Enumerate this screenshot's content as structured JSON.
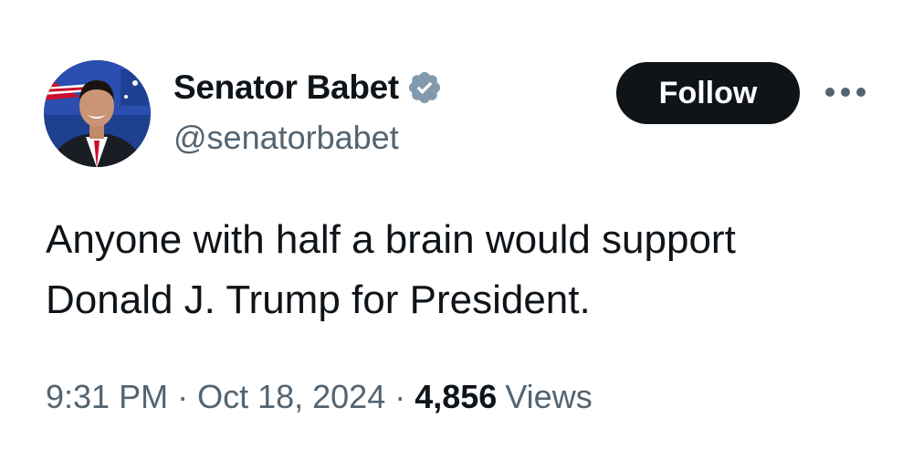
{
  "author": {
    "display_name": "Senator Babet",
    "handle": "@senatorbabet",
    "verified_badge_color": "#829aab",
    "avatar_icon": "profile-photo"
  },
  "actions": {
    "follow_label": "Follow",
    "more_icon": "ellipsis-icon"
  },
  "tweet": {
    "text": "Anyone with half a brain would support\nDonald J. Trump for President.",
    "time": "9:31 PM",
    "separator": "·",
    "date": "Oct 18, 2024",
    "views_count": "4,856",
    "views_label": "Views"
  },
  "colors": {
    "text_primary": "#0f1419",
    "text_secondary": "#536471",
    "button_bg": "#0f1419",
    "button_text": "#ffffff"
  }
}
